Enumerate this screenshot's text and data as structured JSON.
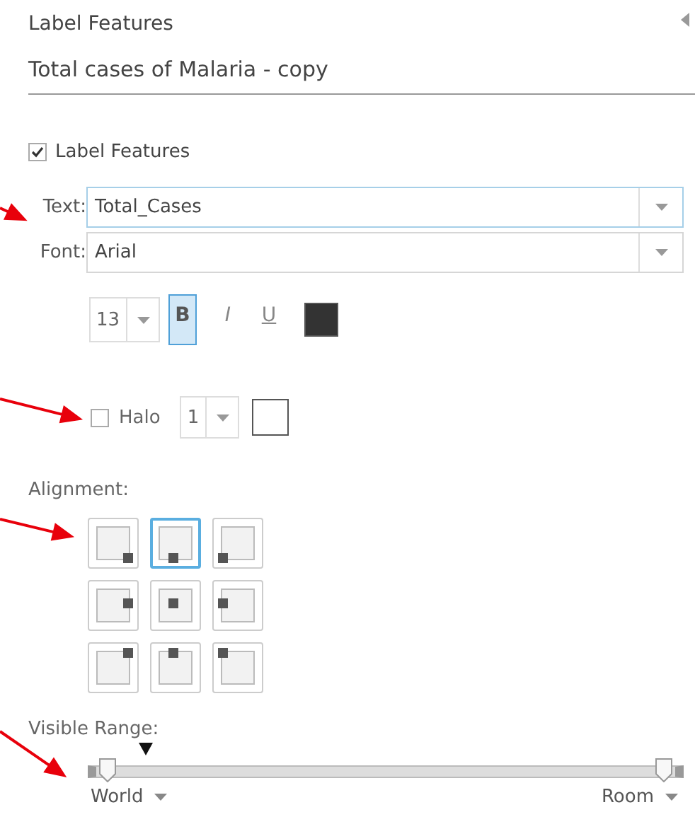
{
  "panel": {
    "title": "Label Features",
    "layer_name": "Total cases of Malaria - copy"
  },
  "label_features": {
    "label": "Label Features",
    "checked": true
  },
  "text_field": {
    "label": "Text:",
    "value": "Total_Cases",
    "focused": true
  },
  "font_field": {
    "label": "Font:",
    "value": "Arial",
    "focused": false
  },
  "style": {
    "size": "13",
    "buttons": [
      {
        "kind": "bold",
        "label": "B",
        "selected": true
      },
      {
        "kind": "italic",
        "label": "I",
        "selected": false
      },
      {
        "kind": "underline",
        "label": "U",
        "selected": false
      }
    ],
    "color": "#333333"
  },
  "halo": {
    "label": "Halo",
    "checked": false,
    "size": "1",
    "color": "#ffffff"
  },
  "alignment": {
    "label": "Alignment:",
    "options": [
      {
        "kind": "br",
        "selected": false
      },
      {
        "kind": "b",
        "selected": true
      },
      {
        "kind": "bl",
        "selected": false
      },
      {
        "kind": "r",
        "selected": false
      },
      {
        "kind": "c",
        "selected": false
      },
      {
        "kind": "l",
        "selected": false
      },
      {
        "kind": "tr",
        "selected": false
      },
      {
        "kind": "t",
        "selected": false
      },
      {
        "kind": "tl",
        "selected": false
      }
    ]
  },
  "visible_range": {
    "label": "Visible Range:",
    "handles": [
      {
        "level": 0.02
      },
      {
        "level": 0.98
      }
    ],
    "current": {
      "level": 0.085
    },
    "min_label": "World",
    "max_label": "Room"
  },
  "annotations": [
    {
      "kind": "arrow"
    },
    {
      "kind": "arrow"
    },
    {
      "kind": "arrow"
    },
    {
      "kind": "arrow"
    }
  ]
}
